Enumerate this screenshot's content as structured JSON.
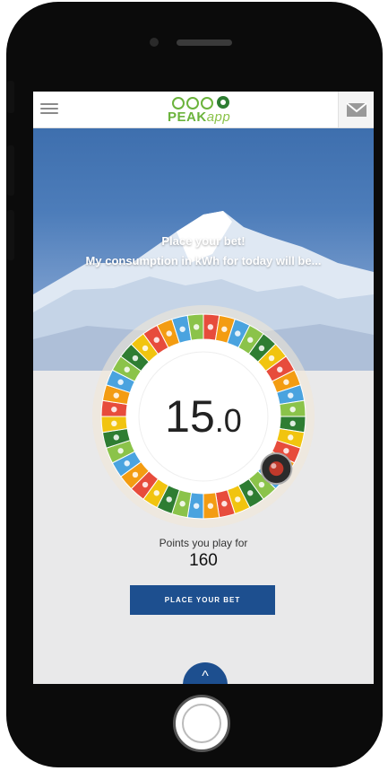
{
  "app": {
    "logo_text_1": "PEAK",
    "logo_text_2": "app"
  },
  "hero": {
    "prompt_line_1": "Place your bet!",
    "prompt_line_2": "My consumption in kWh for today will be..."
  },
  "bet": {
    "value_integer": "15",
    "value_decimal": ".0"
  },
  "points": {
    "label": "Points you play for",
    "value": "160"
  },
  "actions": {
    "place_bet_label": "PLACE YOUR BET",
    "up_label": "^"
  },
  "colors": {
    "accent_blue": "#1d4f8f",
    "logo_green": "#6bb33c",
    "wheel_segments": [
      "#e74c3c",
      "#f39c12",
      "#4aa3df",
      "#8bc34a",
      "#2e7d32",
      "#f1c40f"
    ]
  },
  "icons": {
    "menu": "menu-icon",
    "mail": "mail-icon",
    "home": "home-button",
    "chevron_up": "chevron-up-icon",
    "dial_knob": "dial-knob-icon"
  }
}
